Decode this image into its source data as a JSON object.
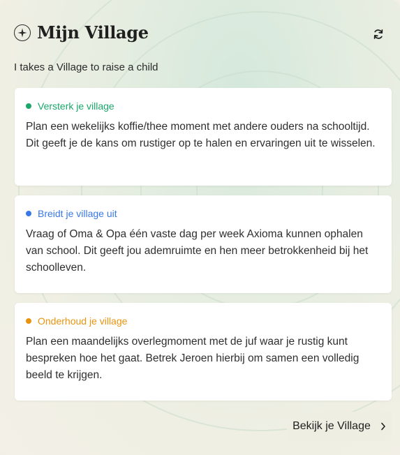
{
  "header": {
    "title": "Mijn Village",
    "icon": "compass-star-icon",
    "refresh_icon": "refresh-icon"
  },
  "subtitle": "I takes a Village to raise a child",
  "cards": [
    {
      "tag": "Versterk je village",
      "color": "#1aa86a",
      "body": "Plan een wekelijks koffie/thee moment met andere ouders na schooltijd. Dit geeft je de kans om rustiger op te halen en ervaringen uit te wisselen."
    },
    {
      "tag": "Breidt je village uit",
      "color": "#3b78e7",
      "body": "Vraag of Oma & Opa één vaste dag per week Axioma kunnen ophalen van school. Dit geeft jou ademruimte en hen meer betrokkenheid bij het schoolleven."
    },
    {
      "tag": "Onderhoud je village",
      "color": "#e8940f",
      "body": "Plan een maandelijks overlegmoment met de juf waar je rustig kunt bespreken hoe het gaat. Betrek Jeroen hierbij om samen een volledig beeld te krijgen."
    }
  ],
  "cta": {
    "label": "Bekijk je Village",
    "icon": "chevron-right-icon"
  }
}
